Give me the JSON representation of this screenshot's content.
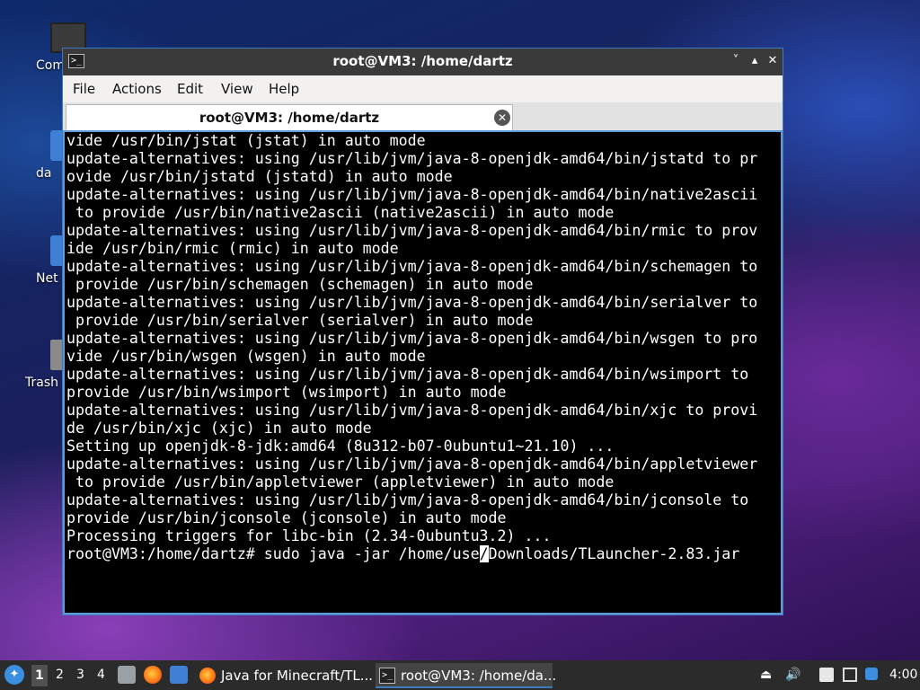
{
  "desktop": {
    "icons": [
      {
        "label": "Com"
      },
      {
        "label": "da"
      },
      {
        "label": "Net"
      },
      {
        "label": "Trash"
      }
    ]
  },
  "window": {
    "title": "root@VM3: /home/dartz",
    "menu": [
      "File",
      "Actions",
      "Edit",
      "View",
      "Help"
    ],
    "tab_title": "root@VM3: /home/dartz",
    "controls": {
      "minimize": "˅",
      "maximize": "▴",
      "close": "✕"
    }
  },
  "terminal": {
    "lines": [
      "vide /usr/bin/jstat (jstat) in auto mode",
      "update-alternatives: using /usr/lib/jvm/java-8-openjdk-amd64/bin/jstatd to pr",
      "ovide /usr/bin/jstatd (jstatd) in auto mode",
      "update-alternatives: using /usr/lib/jvm/java-8-openjdk-amd64/bin/native2ascii",
      " to provide /usr/bin/native2ascii (native2ascii) in auto mode",
      "update-alternatives: using /usr/lib/jvm/java-8-openjdk-amd64/bin/rmic to prov",
      "ide /usr/bin/rmic (rmic) in auto mode",
      "update-alternatives: using /usr/lib/jvm/java-8-openjdk-amd64/bin/schemagen to",
      " provide /usr/bin/schemagen (schemagen) in auto mode",
      "update-alternatives: using /usr/lib/jvm/java-8-openjdk-amd64/bin/serialver to",
      " provide /usr/bin/serialver (serialver) in auto mode",
      "update-alternatives: using /usr/lib/jvm/java-8-openjdk-amd64/bin/wsgen to pro",
      "vide /usr/bin/wsgen (wsgen) in auto mode",
      "update-alternatives: using /usr/lib/jvm/java-8-openjdk-amd64/bin/wsimport to",
      "provide /usr/bin/wsimport (wsimport) in auto mode",
      "update-alternatives: using /usr/lib/jvm/java-8-openjdk-amd64/bin/xjc to provi",
      "de /usr/bin/xjc (xjc) in auto mode",
      "Setting up openjdk-8-jdk:amd64 (8u312-b07-0ubuntu1~21.10) ...",
      "update-alternatives: using /usr/lib/jvm/java-8-openjdk-amd64/bin/appletviewer",
      " to provide /usr/bin/appletviewer (appletviewer) in auto mode",
      "update-alternatives: using /usr/lib/jvm/java-8-openjdk-amd64/bin/jconsole to",
      "provide /usr/bin/jconsole (jconsole) in auto mode",
      "Processing triggers for libc-bin (2.34-0ubuntu3.2) ..."
    ],
    "prompt_before_cursor": "root@VM3:/home/dartz# sudo java -jar /home/use",
    "cursor_char": "/",
    "prompt_after_cursor": "Downloads/TLauncher-2.83.jar"
  },
  "taskbar": {
    "workspaces": [
      "1",
      "2",
      "3",
      "4"
    ],
    "active_workspace": "1",
    "tasks": [
      {
        "label": "Java for Minecraft/TL..."
      },
      {
        "label": "root@VM3: /home/da..."
      }
    ],
    "clock": "4:00"
  }
}
